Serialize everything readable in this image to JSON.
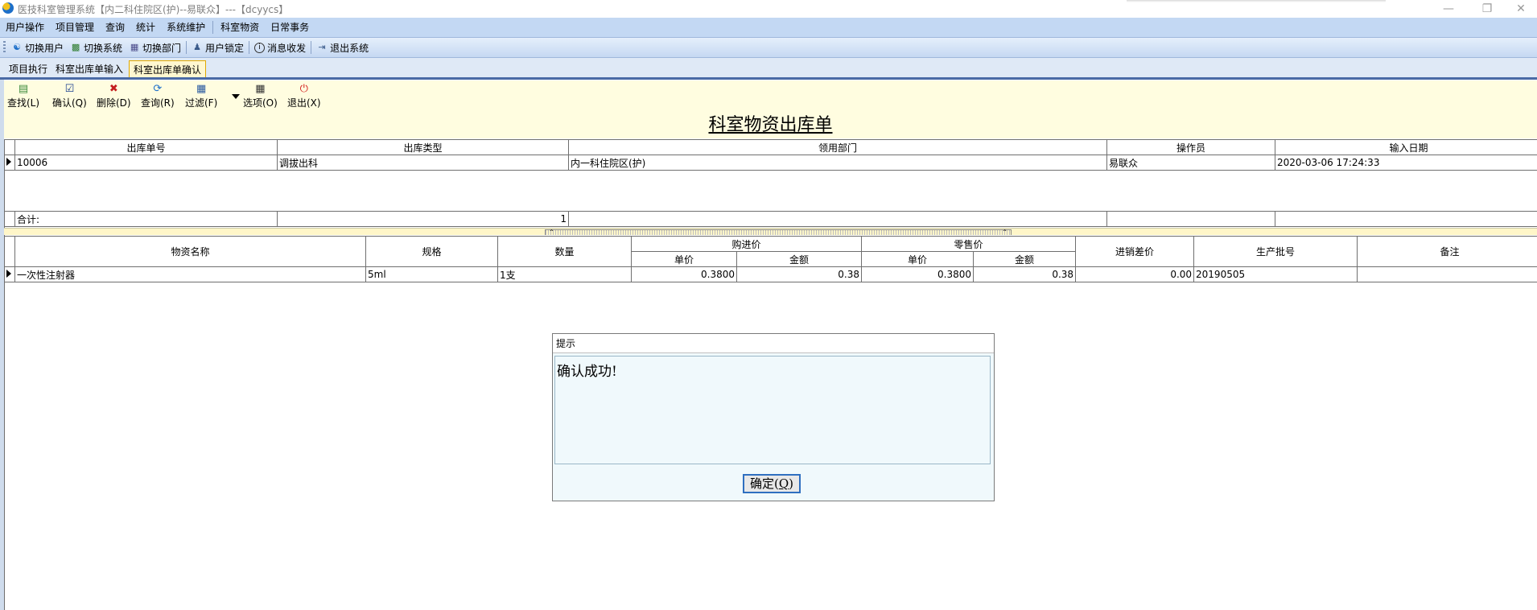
{
  "window": {
    "title": "医技科室管理系统【内二科住院区(护)--易联众】---【dcyycs】",
    "controls": [
      "minimize-icon",
      "restore-icon",
      "close-icon"
    ]
  },
  "menubar": {
    "items": [
      "用户操作",
      "项目管理",
      "查询",
      "统计",
      "系统维护",
      "科室物资",
      "日常事务"
    ]
  },
  "toolbar": {
    "items": [
      {
        "label": "切换用户",
        "icon": "switch-user-icon"
      },
      {
        "label": "切换系统",
        "icon": "switch-system-icon"
      },
      {
        "label": "切换部门",
        "icon": "switch-department-icon"
      },
      {
        "label": "用户锁定",
        "icon": "user-lock-icon"
      },
      {
        "label": "消息收发",
        "icon": "message-icon"
      },
      {
        "label": "退出系统",
        "icon": "exit-system-icon"
      }
    ]
  },
  "tabs": [
    "项目执行",
    "科室出库单输入",
    "科室出库单确认"
  ],
  "active_tab": "科室出库单确认",
  "actions": [
    {
      "label": "查找(L)",
      "icon": "find-icon"
    },
    {
      "label": "确认(Q)",
      "icon": "confirm-checkbox-icon"
    },
    {
      "label": "删除(D)",
      "icon": "delete-icon"
    },
    {
      "label": "查询(R)",
      "icon": "refresh-query-icon"
    },
    {
      "label": "过滤(F)",
      "icon": "filter-icon"
    },
    {
      "label": "选项(O)",
      "icon": "options-icon"
    },
    {
      "label": "退出(X)",
      "icon": "power-exit-icon"
    }
  ],
  "form_title": "科室物资出库单",
  "master": {
    "headers": [
      "出库单号",
      "出库类型",
      "领用部门",
      "操作员",
      "输入日期"
    ],
    "row": [
      "10006",
      "调拔出科",
      "内一科住院区(护)",
      "易联众",
      "2020-03-06 17:24:33"
    ],
    "total_label": "合计:",
    "total_value": "1"
  },
  "detail": {
    "headers": {
      "name": "物资名称",
      "spec": "规格",
      "qty": "数量",
      "purchase": "购进价",
      "retail": "零售价",
      "unit_price": "单价",
      "amount": "金额",
      "diff": "进销差价",
      "batch": "生产批号",
      "remark": "备注"
    },
    "row": {
      "name": "一次性注射器",
      "spec": "5ml",
      "qty": "1支",
      "purchase_price": "0.3800",
      "purchase_amount": "0.38",
      "retail_price": "0.3800",
      "retail_amount": "0.38",
      "diff": "0.00",
      "batch": "20190505",
      "remark": ""
    }
  },
  "dialog": {
    "title": "提示",
    "message": "确认成功!",
    "ok_label": "确定(",
    "ok_key": "Q",
    "ok_suffix": ")"
  }
}
